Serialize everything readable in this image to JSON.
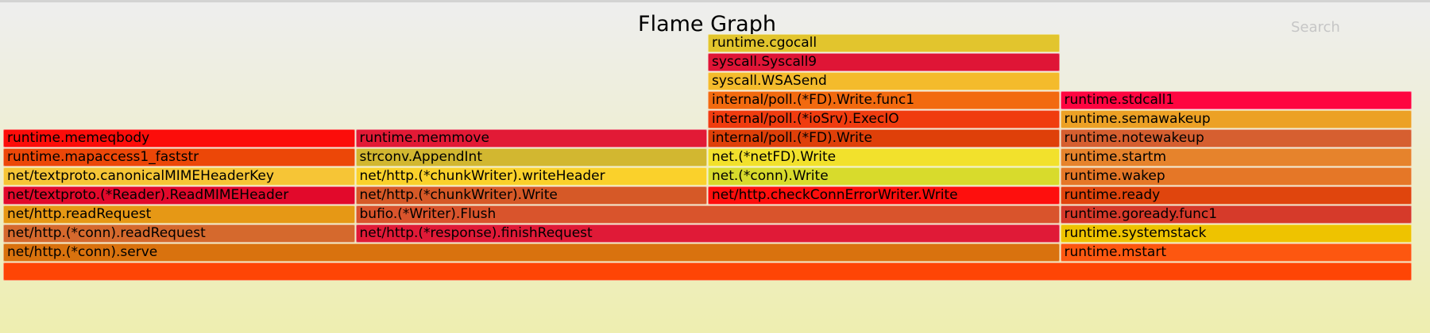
{
  "header": {
    "title": "Flame Graph",
    "search_label": "Search"
  },
  "chart_data": {
    "type": "flamegraph",
    "title": "Flame Graph",
    "total": 1.0,
    "frames": [
      {
        "name": "",
        "depth": 0,
        "start": 0.0,
        "width": 1.0,
        "color": "#fe4505"
      },
      {
        "name": "net/http.(*conn).serve",
        "depth": 1,
        "start": 0.0,
        "width": 0.75,
        "color": "#d9720e"
      },
      {
        "name": "runtime.mstart",
        "depth": 1,
        "start": 0.75,
        "width": 0.25,
        "color": "#fd5710"
      },
      {
        "name": "net/http.(*conn).readRequest",
        "depth": 2,
        "start": 0.0,
        "width": 0.25,
        "color": "#d5692d"
      },
      {
        "name": "net/http.(*response).finishRequest",
        "depth": 2,
        "start": 0.25,
        "width": 0.5,
        "color": "#e01a37"
      },
      {
        "name": "runtime.systemstack",
        "depth": 2,
        "start": 0.75,
        "width": 0.25,
        "color": "#eec300"
      },
      {
        "name": "net/http.readRequest",
        "depth": 3,
        "start": 0.0,
        "width": 0.25,
        "color": "#e69815"
      },
      {
        "name": "bufio.(*Writer).Flush",
        "depth": 3,
        "start": 0.25,
        "width": 0.5,
        "color": "#d9542c"
      },
      {
        "name": "runtime.goready.func1",
        "depth": 3,
        "start": 0.75,
        "width": 0.25,
        "color": "#d63a2a"
      },
      {
        "name": "net/textproto.(*Reader).ReadMIMEHeader",
        "depth": 4,
        "start": 0.0,
        "width": 0.25,
        "color": "#e2092b"
      },
      {
        "name": "net/http.(*chunkWriter).Write",
        "depth": 4,
        "start": 0.25,
        "width": 0.25,
        "color": "#d65927"
      },
      {
        "name": "net/http.checkConnErrorWriter.Write",
        "depth": 4,
        "start": 0.5,
        "width": 0.25,
        "color": "#fe0f0d"
      },
      {
        "name": "runtime.ready",
        "depth": 4,
        "start": 0.75,
        "width": 0.25,
        "color": "#e0450d"
      },
      {
        "name": "net/textproto.canonicalMIMEHeaderKey",
        "depth": 5,
        "start": 0.0,
        "width": 0.25,
        "color": "#f6c536"
      },
      {
        "name": "net/http.(*chunkWriter).writeHeader",
        "depth": 5,
        "start": 0.25,
        "width": 0.25,
        "color": "#fad12b"
      },
      {
        "name": "net.(*conn).Write",
        "depth": 5,
        "start": 0.5,
        "width": 0.25,
        "color": "#d8db2c"
      },
      {
        "name": "runtime.wakep",
        "depth": 5,
        "start": 0.75,
        "width": 0.25,
        "color": "#e57727"
      },
      {
        "name": "runtime.mapaccess1_faststr",
        "depth": 6,
        "start": 0.0,
        "width": 0.25,
        "color": "#ec4708"
      },
      {
        "name": "strconv.AppendInt",
        "depth": 6,
        "start": 0.25,
        "width": 0.25,
        "color": "#d2b730"
      },
      {
        "name": "net.(*netFD).Write",
        "depth": 6,
        "start": 0.5,
        "width": 0.25,
        "color": "#f2e12c"
      },
      {
        "name": "runtime.startm",
        "depth": 6,
        "start": 0.75,
        "width": 0.25,
        "color": "#e6832c"
      },
      {
        "name": "runtime.memeqbody",
        "depth": 7,
        "start": 0.0,
        "width": 0.25,
        "color": "#fc0d0a"
      },
      {
        "name": "runtime.memmove",
        "depth": 7,
        "start": 0.25,
        "width": 0.25,
        "color": "#e21a36"
      },
      {
        "name": "internal/poll.(*FD).Write",
        "depth": 7,
        "start": 0.5,
        "width": 0.25,
        "color": "#df4009"
      },
      {
        "name": "runtime.notewakeup",
        "depth": 7,
        "start": 0.75,
        "width": 0.25,
        "color": "#d65f30"
      },
      {
        "name": "internal/poll.(*ioSrv).ExecIO",
        "depth": 8,
        "start": 0.5,
        "width": 0.25,
        "color": "#f03c0f"
      },
      {
        "name": "runtime.semawakeup",
        "depth": 8,
        "start": 0.75,
        "width": 0.25,
        "color": "#eca125"
      },
      {
        "name": "internal/poll.(*FD).Write.func1",
        "depth": 9,
        "start": 0.5,
        "width": 0.25,
        "color": "#f26a0f"
      },
      {
        "name": "runtime.stdcall1",
        "depth": 9,
        "start": 0.75,
        "width": 0.25,
        "color": "#fe0540"
      },
      {
        "name": "syscall.WSASend",
        "depth": 10,
        "start": 0.5,
        "width": 0.25,
        "color": "#f4bb2c"
      },
      {
        "name": "syscall.Syscall9",
        "depth": 11,
        "start": 0.5,
        "width": 0.25,
        "color": "#df1536"
      },
      {
        "name": "runtime.cgocall",
        "depth": 12,
        "start": 0.5,
        "width": 0.25,
        "color": "#e2c52d"
      }
    ]
  }
}
